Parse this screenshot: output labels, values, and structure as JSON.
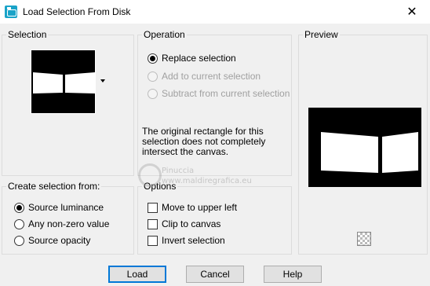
{
  "window": {
    "title": "Load Selection From Disk",
    "close_glyph": "✕"
  },
  "selection": {
    "group_label": "Selection"
  },
  "operation": {
    "group_label": "Operation",
    "options": [
      {
        "label": "Replace selection",
        "checked": true,
        "enabled": true
      },
      {
        "label": "Add to current selection",
        "checked": false,
        "enabled": false
      },
      {
        "label": "Subtract from current selection",
        "checked": false,
        "enabled": false
      }
    ],
    "note": "The original rectangle for this selection does not completely intersect the canvas."
  },
  "preview": {
    "group_label": "Preview"
  },
  "create_from": {
    "group_label": "Create selection from:",
    "options": [
      {
        "label": "Source luminance",
        "checked": true
      },
      {
        "label": "Any non-zero value",
        "checked": false
      },
      {
        "label": "Source opacity",
        "checked": false
      }
    ]
  },
  "options": {
    "group_label": "Options",
    "checkboxes": [
      {
        "label": "Move to upper left",
        "checked": false
      },
      {
        "label": "Clip to canvas",
        "checked": false
      },
      {
        "label": "Invert selection",
        "checked": false
      }
    ]
  },
  "watermark": {
    "line1": "Pinuccia",
    "line2": "www.maldiregrafica.eu"
  },
  "buttons": {
    "load": "Load",
    "cancel": "Cancel",
    "help": "Help"
  },
  "colors": {
    "accent": "#0078d7",
    "app_icon": "#1aa3c8"
  }
}
